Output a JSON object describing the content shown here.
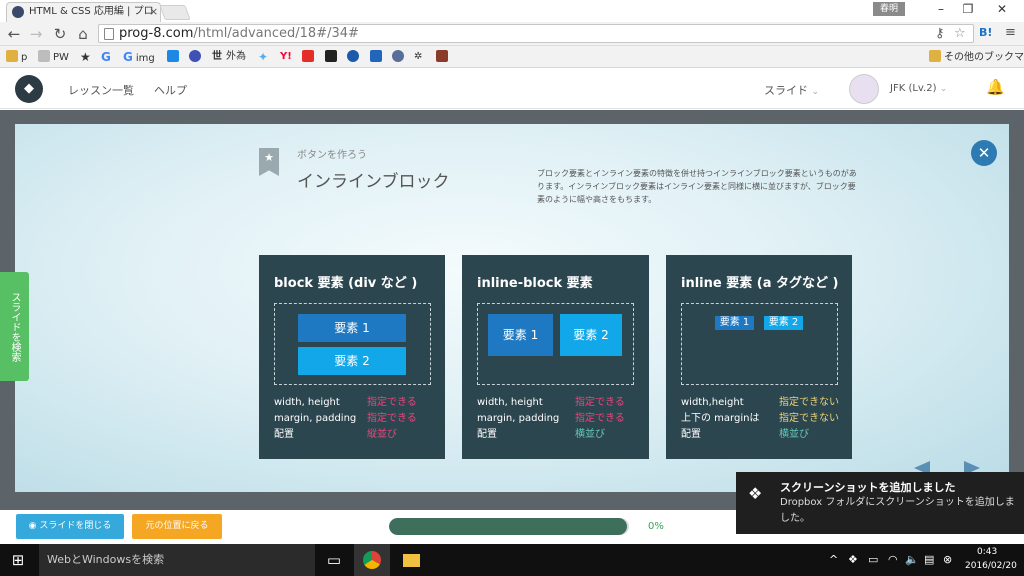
{
  "browser": {
    "tab_title": "HTML & CSS 応用編 | プロ",
    "tab_close": "×",
    "profile_badge": "春明",
    "url_host": "prog-8.com",
    "url_path": "/html/advanced/18#/34#",
    "bookmarks": [
      {
        "label": "p",
        "color": "#e0b040"
      },
      {
        "label": "PW",
        "color": "#bdbdbd"
      },
      {
        "label": "",
        "color": "#444444"
      },
      {
        "label": "",
        "color": "#4285f4"
      },
      {
        "label": "img",
        "color": "#4285f4"
      },
      {
        "label": "",
        "color": "#1e88e5"
      },
      {
        "label": "",
        "color": "#3f51b5"
      },
      {
        "label": "外為",
        "color": "#222222"
      },
      {
        "label": "",
        "color": "#55acee"
      },
      {
        "label": "",
        "color": "#ff0033"
      },
      {
        "label": "",
        "color": "#e52d27"
      },
      {
        "label": "",
        "color": "#222222"
      },
      {
        "label": "",
        "color": "#1a5aa8"
      },
      {
        "label": "",
        "color": "#2266bb"
      },
      {
        "label": "",
        "color": "#5a6e9a"
      },
      {
        "label": "",
        "color": "#777777"
      },
      {
        "label": "",
        "color": "#8a3b2a"
      }
    ],
    "other_bookmarks": "その他のブックマーク"
  },
  "site": {
    "lessons": "レッスン一覧",
    "help": "ヘルプ",
    "slide_menu": "スライド",
    "user": "JFK (Lv.2)"
  },
  "slide": {
    "subtitle": "ボタンを作ろう",
    "title": "インラインブロック",
    "description": "ブロック要素とインライン要素の特徴を併せ持つインラインブロック要素というものがあります。インラインブロック要素はインライン要素と同様に横に並びますが、ブロック要素のように幅や高さをもちます。",
    "cards": [
      {
        "heading": "block 要素 (div など )",
        "elements": [
          "要素 1",
          "要素 2"
        ],
        "rows": [
          {
            "label": "width, height",
            "value": "指定できる"
          },
          {
            "label": "margin, padding",
            "value": "指定できる"
          },
          {
            "label": "配置",
            "value": "縦並び"
          }
        ]
      },
      {
        "heading": "inline-block 要素",
        "elements": [
          "要素 1",
          "要素 2"
        ],
        "rows": [
          {
            "label": "width, height",
            "value": "指定できる"
          },
          {
            "label": "margin, padding",
            "value": "指定できる"
          },
          {
            "label": "配置",
            "value": "横並び"
          }
        ]
      },
      {
        "heading": "inline 要素 (a タグなど )",
        "elements": [
          "要素 1",
          "要素 2"
        ],
        "rows": [
          {
            "label": "width,height",
            "value": "指定できない"
          },
          {
            "label": "上下の marginは",
            "value": "指定できない"
          },
          {
            "label": "配置",
            "value": "横並び"
          }
        ]
      }
    ]
  },
  "side_tab": "スライドを検索",
  "bottom": {
    "close_slide": "スライドを閉じる",
    "return_position": "元の位置に戻る",
    "progress_percent": "0%",
    "progress_fraction": 0.99
  },
  "toast": {
    "title": "スクリーンショットを追加しました",
    "body": "Dropbox フォルダにスクリーンショットを追加しました。"
  },
  "taskbar": {
    "search": "WebとWindowsを検索",
    "time": "0:43",
    "date": "2016/02/20"
  },
  "colors": {
    "card_bg": "#2c4650",
    "el_dark": "#1e78c2",
    "el_light": "#12a7e8",
    "val_pink": "#e8467c",
    "val_yellow": "#e9d27a",
    "val_teal": "#67c7b6",
    "side_tab": "#58c064",
    "close_btn": "#35a8dc",
    "return_btn": "#f5a623",
    "progress_fill": "#3e6e5c"
  }
}
